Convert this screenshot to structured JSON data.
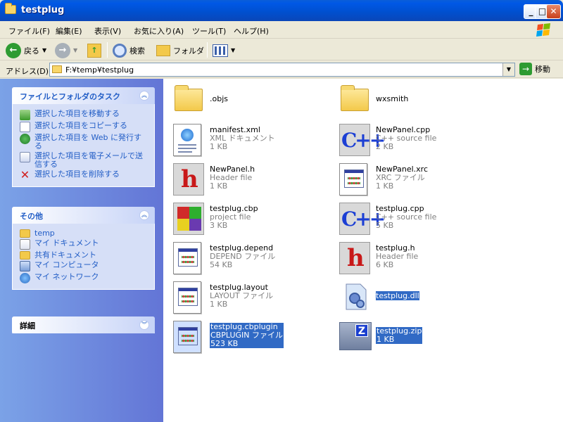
{
  "window": {
    "title": "testplug"
  },
  "menu": [
    "ファイル(F)",
    "編集(E)",
    "表示(V)",
    "お気に入り(A)",
    "ツール(T)",
    "ヘルプ(H)"
  ],
  "toolbar": {
    "back": "戻る",
    "search": "検索",
    "folders": "フォルダ"
  },
  "address": {
    "label": "アドレス(D)",
    "value": "F:¥temp¥testplug",
    "go": "移動"
  },
  "tasks_panel": {
    "title": "ファイルとフォルダのタスク",
    "items": [
      "選択した項目を移動する",
      "選択した項目をコピーする",
      "選択した項目を Web に発行する",
      "選択した項目を電子メールで送信する",
      "選択した項目を削除する"
    ]
  },
  "other_panel": {
    "title": "その他",
    "items": [
      "temp",
      "マイ ドキュメント",
      "共有ドキュメント",
      "マイ コンピュータ",
      "マイ ネットワーク"
    ]
  },
  "details_panel": {
    "title": "詳細"
  },
  "files": [
    {
      "name": ".objs",
      "type": "",
      "size": "",
      "icon": "folder-icon",
      "selected": false
    },
    {
      "name": "wxsmith",
      "type": "",
      "size": "",
      "icon": "folder-icon",
      "selected": false
    },
    {
      "name": "manifest.xml",
      "type": "XML ドキュメント",
      "size": "1 KB",
      "icon": "xml-document-icon",
      "selected": false
    },
    {
      "name": "NewPanel.cpp",
      "type": "C++ source file",
      "size": "2 KB",
      "icon": "cpp-file-icon",
      "selected": false
    },
    {
      "name": "NewPanel.h",
      "type": "Header file",
      "size": "1 KB",
      "icon": "header-file-icon",
      "selected": false
    },
    {
      "name": "NewPanel.xrc",
      "type": "XRC ファイル",
      "size": "1 KB",
      "icon": "generic-file-icon",
      "selected": false
    },
    {
      "name": "testplug.cbp",
      "type": "project file",
      "size": "3 KB",
      "icon": "codeblocks-project-icon",
      "selected": false
    },
    {
      "name": "testplug.cpp",
      "type": "C++ source file",
      "size": "5 KB",
      "icon": "cpp-file-icon",
      "selected": false
    },
    {
      "name": "testplug.depend",
      "type": "DEPEND ファイル",
      "size": "54 KB",
      "icon": "generic-file-icon",
      "selected": false
    },
    {
      "name": "testplug.h",
      "type": "Header file",
      "size": "6 KB",
      "icon": "header-file-icon",
      "selected": false
    },
    {
      "name": "testplug.layout",
      "type": "LAYOUT ファイル",
      "size": "1 KB",
      "icon": "generic-file-icon",
      "selected": false
    },
    {
      "name": "testplug.dll",
      "type": "",
      "size": "",
      "icon": "dll-file-icon",
      "selected": true
    },
    {
      "name": "testplug.cbplugin",
      "type": "CBPLUGIN ファイル",
      "size": "523 KB",
      "icon": "generic-file-icon",
      "selected": true
    },
    {
      "name": "testplug.zip",
      "type": "",
      "size": "1 KB",
      "icon": "zip-file-icon",
      "selected": true
    }
  ]
}
